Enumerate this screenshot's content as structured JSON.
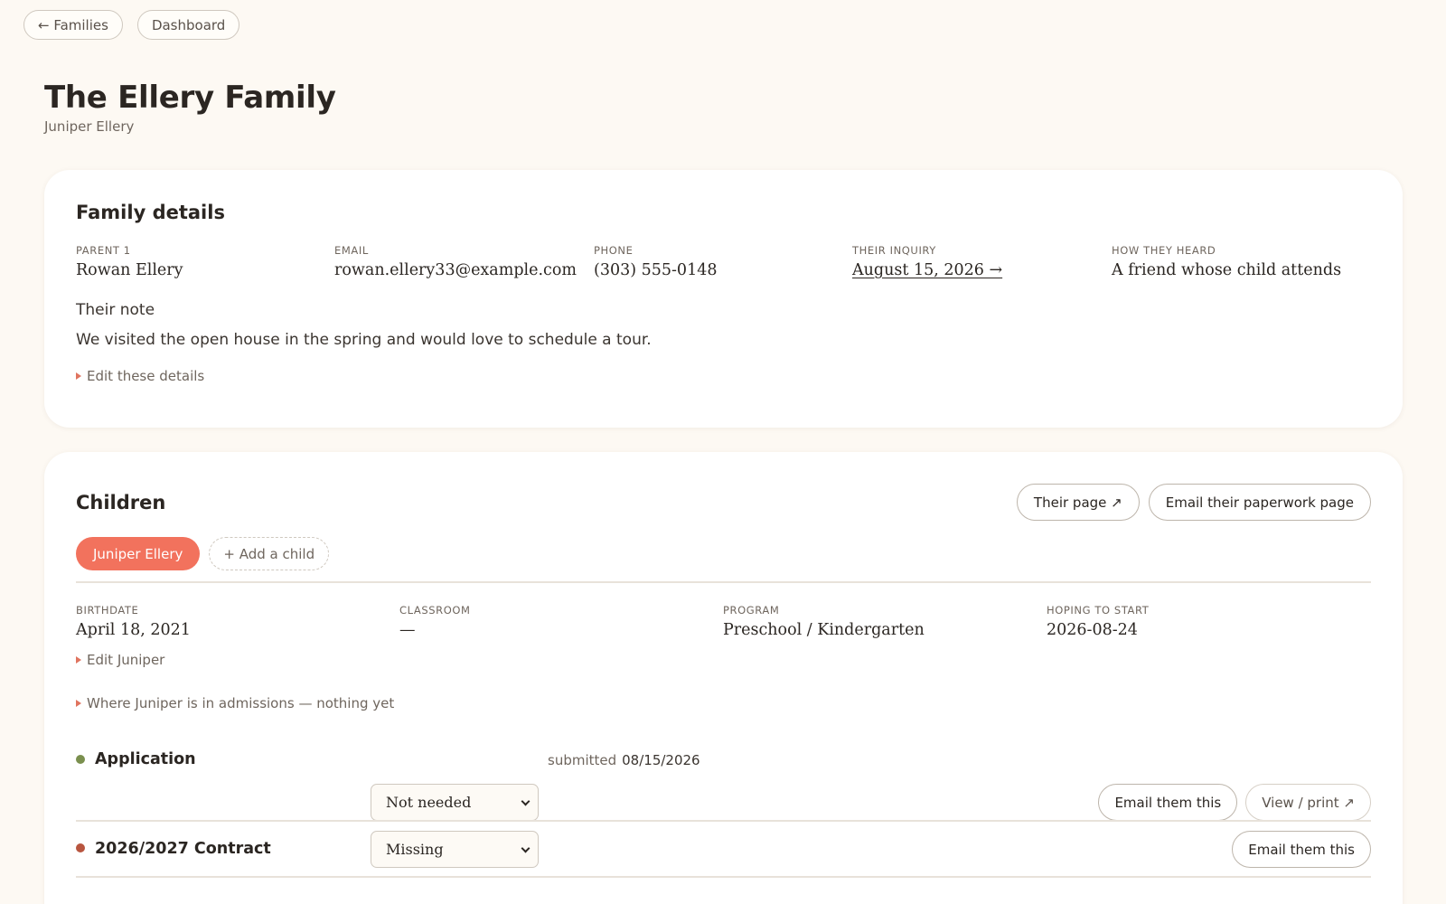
{
  "nav": {
    "back_label": "← Families",
    "dashboard_label": "Dashboard"
  },
  "header": {
    "title": "The Ellery Family",
    "subtitle": "Juniper Ellery"
  },
  "family_details": {
    "title": "Family details",
    "fields": [
      {
        "label": "PARENT 1",
        "value": "Rowan Ellery"
      },
      {
        "label": "EMAIL",
        "value": "rowan.ellery33@example.com"
      },
      {
        "label": "PHONE",
        "value": "(303) 555-0148"
      },
      {
        "label": "THEIR INQUIRY",
        "value": "August 15, 2026 →"
      },
      {
        "label": "HOW THEY HEARD",
        "value": "A friend whose child attends"
      }
    ],
    "note_label": "Their note",
    "note_text": "We visited the open house in the spring and would love to schedule a tour.",
    "edit_label": "Edit these details"
  },
  "children": {
    "title": "Children",
    "their_page_label": "Their page ↗",
    "email_paperwork_label": "Email their paperwork page",
    "active_child": "Juniper Ellery",
    "add_child_label": "+ Add a child",
    "fields": [
      {
        "label": "BIRTHDATE",
        "value": "April 18, 2021"
      },
      {
        "label": "CLASSROOM",
        "value": "—"
      },
      {
        "label": "PROGRAM",
        "value": "Preschool / Kindergarten"
      },
      {
        "label": "HOPING TO START",
        "value": "2026-08-24"
      }
    ],
    "edit_child_label": "Edit Juniper",
    "admissions_label": "Where Juniper is in admissions — nothing yet"
  },
  "documents": [
    {
      "name": "Application",
      "status_color": "#7a8f4e",
      "submitted_label": "submitted",
      "submitted_date": "08/15/2026",
      "select_value": "Not needed",
      "email_label": "Email them this",
      "view_label": "View / print ↗"
    },
    {
      "name": "2026/2027 Contract",
      "status_color": "#b8553f",
      "select_value": "Missing",
      "email_label": "Email them this"
    }
  ],
  "colors": {
    "accent": "#f2725d",
    "background": "#fdf9f3"
  }
}
